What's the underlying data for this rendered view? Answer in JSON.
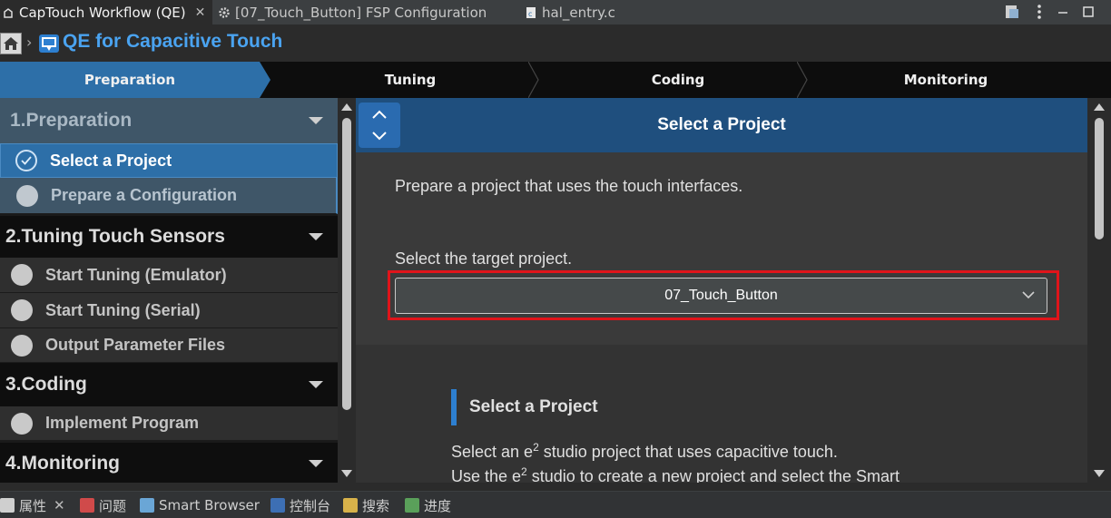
{
  "editor_tabs": [
    {
      "label": "CapTouch Workflow (QE)",
      "close": "✕"
    },
    {
      "label": "[07_Touch_Button] FSP Configuration"
    },
    {
      "label": "hal_entry.c"
    }
  ],
  "header": {
    "title": "QE for Capacitive Touch"
  },
  "workflow_steps": [
    "Preparation",
    "Tuning",
    "Coding",
    "Monitoring"
  ],
  "sidebar": {
    "sections": [
      {
        "title": "1.Preparation",
        "items": [
          "Select a Project",
          "Prepare a Configuration"
        ]
      },
      {
        "title": "2.Tuning Touch Sensors",
        "items": [
          "Start Tuning (Emulator)",
          "Start Tuning (Serial)",
          "Output Parameter Files"
        ]
      },
      {
        "title": "3.Coding",
        "items": [
          "Implement Program"
        ]
      },
      {
        "title": "4.Monitoring"
      }
    ]
  },
  "main": {
    "title": "Select a Project",
    "intro": "Prepare a project that uses the touch interfaces.",
    "target_label": "Select the target project.",
    "target_value": "07_Touch_Button",
    "subsection_title": "Select a Project",
    "desc_line1_a": "Select an e",
    "desc_line1_b": " studio project that uses capacitive touch.",
    "desc_line2_a": "Use the e",
    "desc_line2_b": " studio to create a new project and select the Smart",
    "superscript": "2"
  },
  "bottom_tabs": [
    "属性",
    "问题",
    "Smart Browser",
    "控制台",
    "搜索",
    "进度"
  ],
  "colors": {
    "accent": "#2d6fa8",
    "highlight_box": "#e0141a",
    "title_blue": "#4aa3f0"
  }
}
